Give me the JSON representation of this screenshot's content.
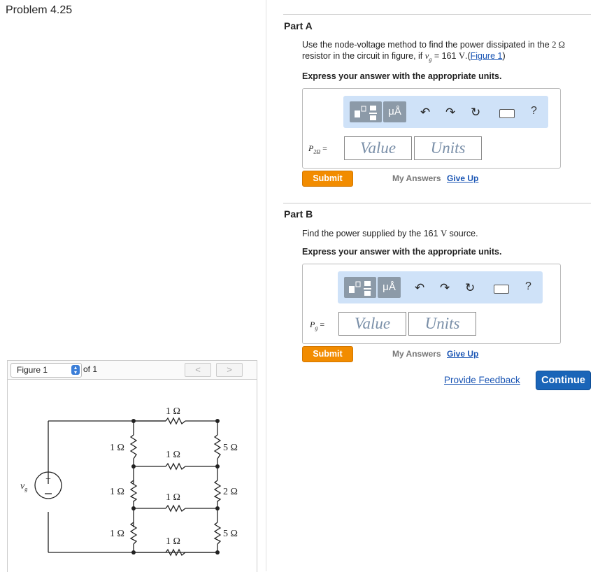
{
  "problem_title": "Problem 4.25",
  "figure": {
    "select_label": "Figure 1",
    "of_label": "of 1",
    "prev": "<",
    "next": ">",
    "source_label": "v",
    "source_sub": "g",
    "resistors": {
      "top1": "1 Ω",
      "mid1": "1 Ω",
      "mid2": "1 Ω",
      "bot1": "1 Ω",
      "left1": "1 Ω",
      "left2": "1 Ω",
      "left3": "1 Ω",
      "right1": "5 Ω",
      "right2": "2 Ω",
      "right3": "5 Ω"
    }
  },
  "partA": {
    "title": "Part A",
    "q_line1": "Use the node-voltage method to find the power dissipated in the",
    "q_res": "2 Ω",
    "q_line2a": "resistor in the circuit in figure, if",
    "q_var": "v",
    "q_var_sub": "g",
    "q_eq": " = 161",
    "q_unit": "V",
    "q_dot": ".(",
    "q_link": "Figure 1",
    "q_close": ")",
    "instruction": "Express your answer with the appropriate units.",
    "eq_label": "P",
    "eq_sub": "2Ω",
    "eq_sign": "=",
    "value_placeholder": "Value",
    "units_placeholder": "Units",
    "submit": "Submit",
    "my_answers": "My Answers",
    "give_up": "Give Up"
  },
  "partB": {
    "title": "Part B",
    "q_text": "Find the power supplied by the 161",
    "q_unit": "V",
    "q_end": "source.",
    "instruction": "Express your answer with the appropriate units.",
    "eq_label": "P",
    "eq_sub": "g",
    "eq_sign": "=",
    "value_placeholder": "Value",
    "units_placeholder": "Units",
    "submit": "Submit",
    "my_answers": "My Answers",
    "give_up": "Give Up"
  },
  "toolbar": {
    "mu_label": "μÅ",
    "help": "?"
  },
  "footer": {
    "feedback": "Provide Feedback",
    "continue": "Continue"
  }
}
